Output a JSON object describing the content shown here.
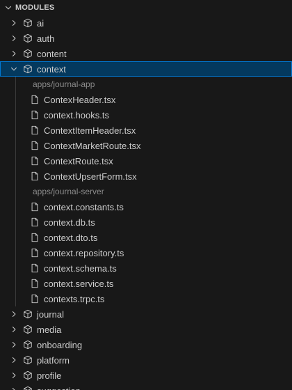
{
  "section": {
    "title": "MODULES"
  },
  "folders_before": [
    {
      "label": "ai"
    },
    {
      "label": "auth"
    },
    {
      "label": "content"
    }
  ],
  "expanded_folder": {
    "label": "context",
    "groups": [
      {
        "label": "apps/journal-app",
        "files": [
          {
            "label": "ContexHeader.tsx"
          },
          {
            "label": "context.hooks.ts"
          },
          {
            "label": "ContextItemHeader.tsx"
          },
          {
            "label": "ContextMarketRoute.tsx"
          },
          {
            "label": "ContextRoute.tsx"
          },
          {
            "label": "ContextUpsertForm.tsx"
          }
        ]
      },
      {
        "label": "apps/journal-server",
        "files": [
          {
            "label": "context.constants.ts"
          },
          {
            "label": "context.db.ts"
          },
          {
            "label": "context.dto.ts"
          },
          {
            "label": "context.repository.ts"
          },
          {
            "label": "context.schema.ts"
          },
          {
            "label": "context.service.ts"
          },
          {
            "label": "contexts.trpc.ts"
          }
        ]
      }
    ]
  },
  "folders_after": [
    {
      "label": "journal"
    },
    {
      "label": "media"
    },
    {
      "label": "onboarding"
    },
    {
      "label": "platform"
    },
    {
      "label": "profile"
    },
    {
      "label": "suggestion"
    }
  ],
  "colors": {
    "background": "#181818",
    "selection": "#04395e",
    "selection_border": "#0078d4",
    "text": "#cccccc",
    "muted_text": "#8b8b8b"
  },
  "icons": {
    "collapsed": "chevron-right-icon",
    "expanded": "chevron-down-icon",
    "module": "package-icon",
    "file": "file-icon"
  }
}
